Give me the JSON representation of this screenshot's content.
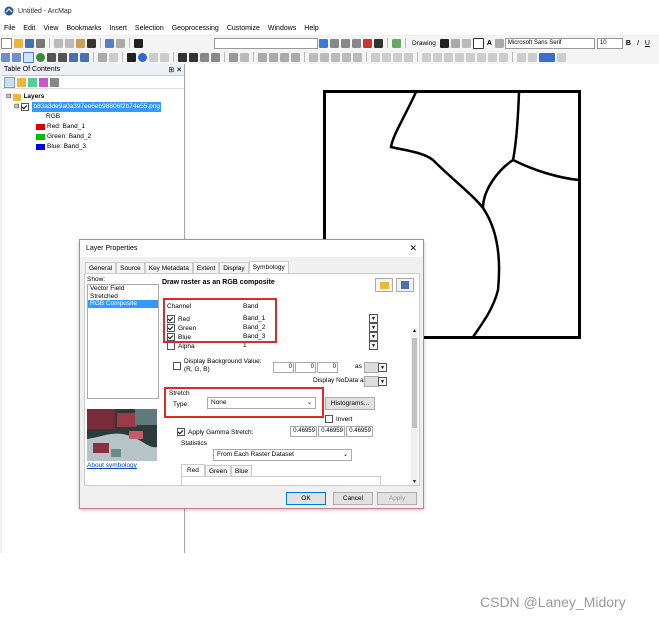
{
  "window": {
    "title": "Untitled - ArcMap"
  },
  "menu": [
    "File",
    "Edit",
    "View",
    "Bookmarks",
    "Insert",
    "Selection",
    "Geoprocessing",
    "Customize",
    "Windows",
    "Help"
  ],
  "toolbar": {
    "drawing_label": "Drawing",
    "font": "Microsoft Sans Serif",
    "font_size": "10",
    "bold": "B",
    "italic": "I",
    "underline": "U"
  },
  "toc": {
    "title": "Table Of Contents",
    "layers_label": "Layers",
    "layer_name": "b83a3de9a0a397ee6eb98806f2b74e55.png",
    "rgb_label": "RGB",
    "bands": [
      {
        "label": "Red:",
        "band": "Band_1",
        "color": "#e00000"
      },
      {
        "label": "Green:",
        "band": "Band_2",
        "color": "#00c000"
      },
      {
        "label": "Blue:",
        "band": "Band_3",
        "color": "#0000e0"
      }
    ]
  },
  "dialog": {
    "title": "Layer Properties",
    "tabs": [
      "General",
      "Source",
      "Key Metadata",
      "Extent",
      "Display",
      "Symbology"
    ],
    "active_tab": "Symbology",
    "show_label": "Show:",
    "show_items": [
      "Vector Field",
      "Stretched",
      "RGB Composite"
    ],
    "selected_show": "RGB Composite",
    "heading": "Draw raster as an RGB composite",
    "channel_header": "Channel",
    "band_header": "Band",
    "channels": [
      {
        "name": "Red",
        "band": "Band_1",
        "checked": true
      },
      {
        "name": "Green",
        "band": "Band_2",
        "checked": true
      },
      {
        "name": "Blue",
        "band": "Band_3",
        "checked": true
      },
      {
        "name": "Alpha",
        "band": "1",
        "checked": false
      }
    ],
    "display_bg_label": "Display Background Value:(R, G, B)",
    "bg_values": [
      "0",
      "0",
      "0"
    ],
    "as_label": "as",
    "nodata_label": "Display NoData as",
    "stretch_label": "Stretch",
    "type_label": "Type:",
    "stretch_type": "None",
    "histograms_button": "Histograms...",
    "invert_label": "Invert",
    "gamma_label": "Apply Gamma Stretch:",
    "gamma_values": [
      "0.46959",
      "0.46959",
      "0.46959"
    ],
    "statistics_label": "Statistics",
    "statistics_value": "From Each Raster Dataset",
    "subtabs": [
      "Red",
      "Green",
      "Blue"
    ],
    "about_link": "About symbology",
    "ok": "OK",
    "cancel": "Cancel",
    "apply": "Apply"
  },
  "watermark": "CSDN @Laney_Midory"
}
